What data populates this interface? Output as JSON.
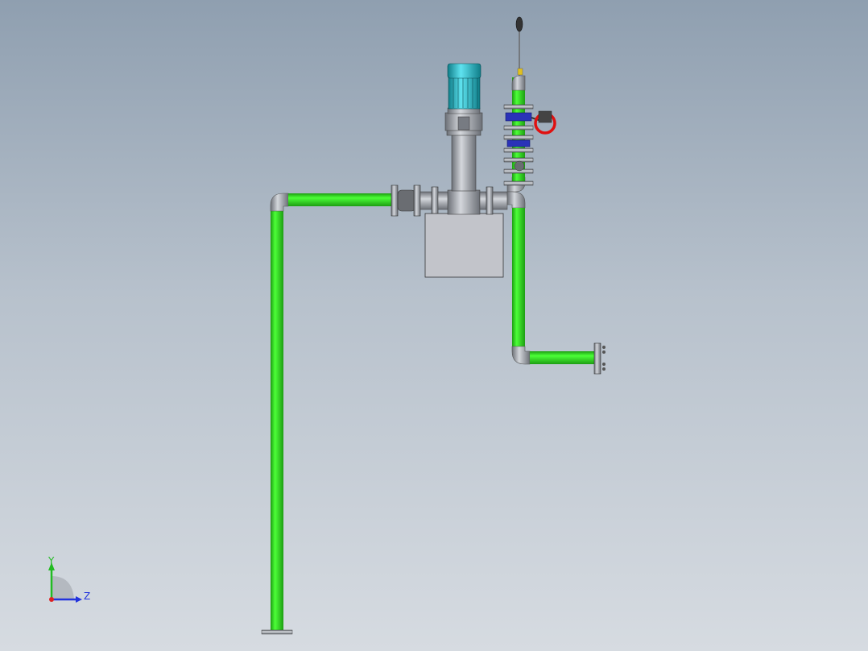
{
  "triad": {
    "y_label": "Y",
    "z_label": "Z",
    "y_color": "#22bb22",
    "z_color": "#2233dd",
    "x_color": "#dd2222"
  },
  "colors": {
    "pipe": "#33e61f",
    "pipe_dark": "#1d9e12",
    "steel": "#9a9ea6",
    "steel_dark": "#55585e",
    "motor": "#1fb9c9",
    "valve_body": "#2a32b8",
    "handwheel": "#e01010",
    "base_block": "#bfc1c7"
  }
}
